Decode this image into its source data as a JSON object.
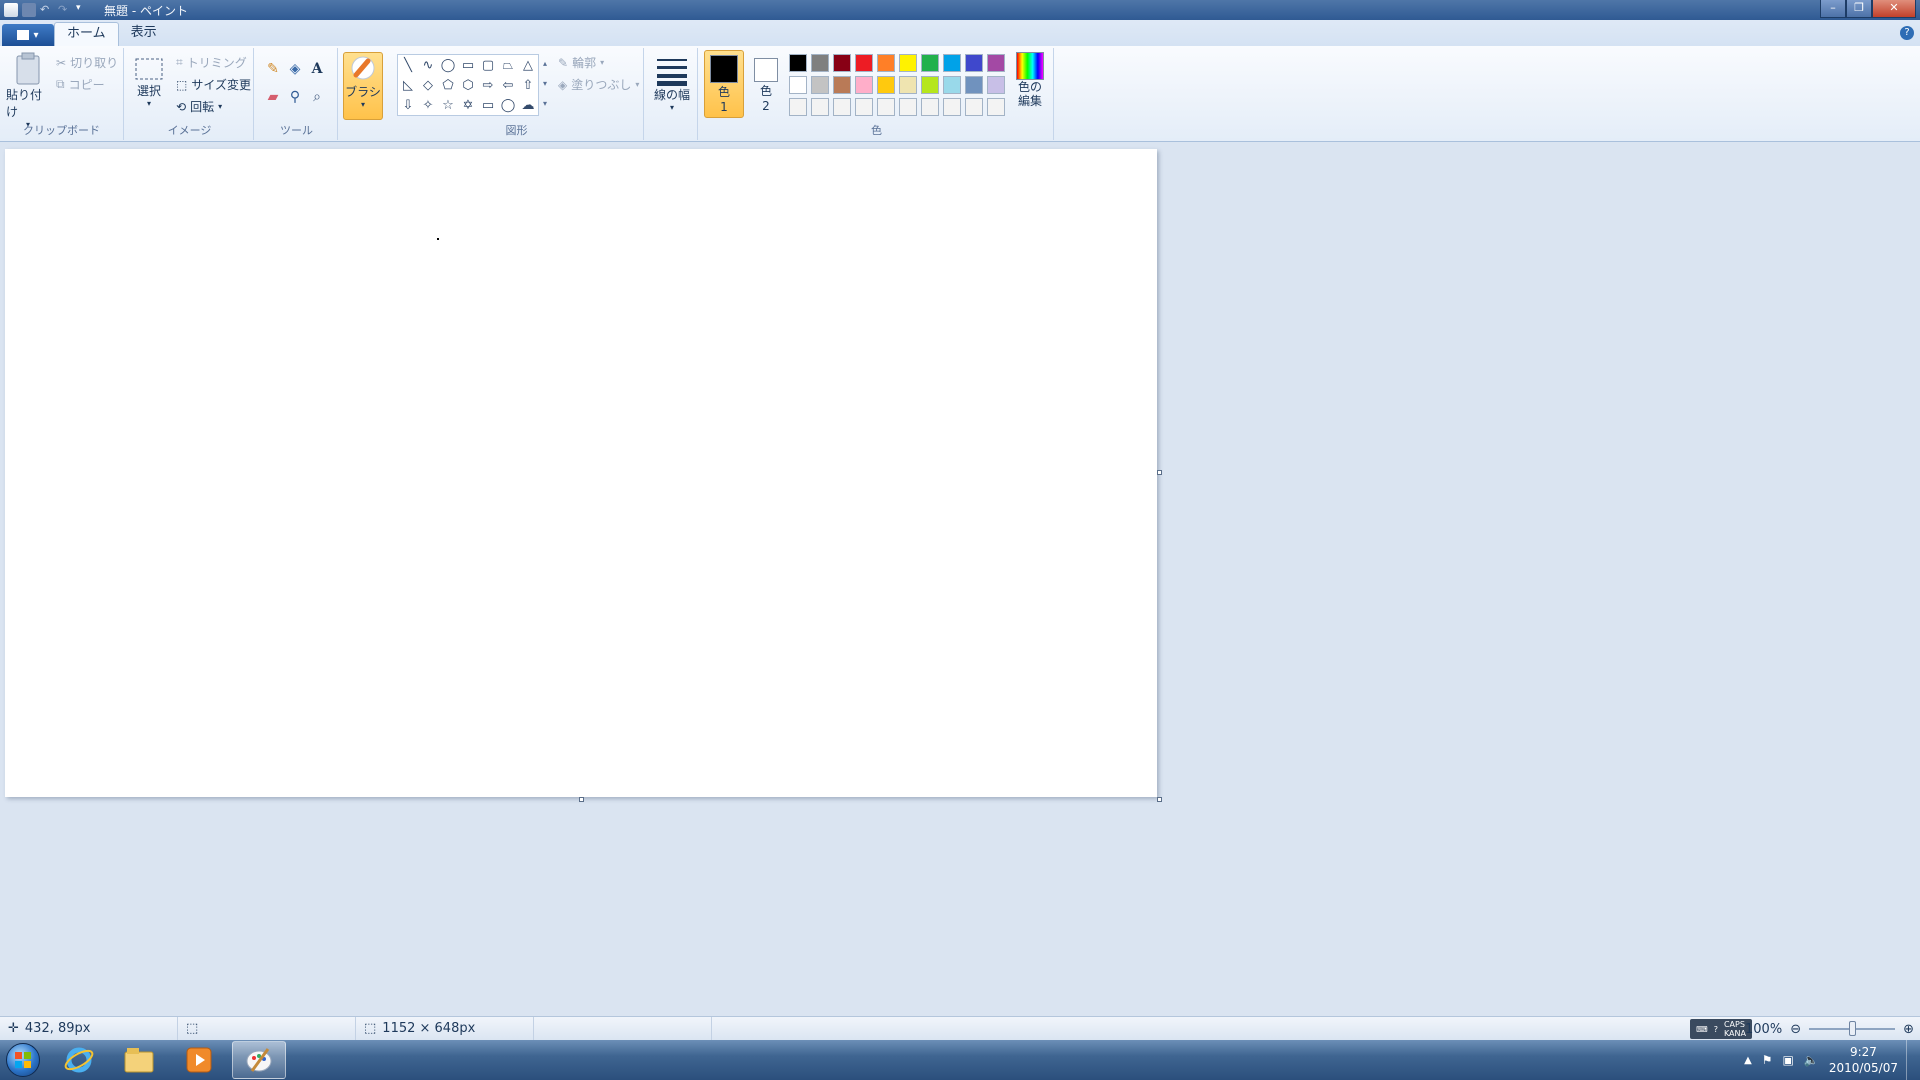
{
  "window": {
    "title": "無題 - ペイント"
  },
  "tabs": [
    {
      "label": "ホーム"
    },
    {
      "label": "表示"
    }
  ],
  "clipboard": {
    "paste": "貼り付け",
    "cut": "切り取り",
    "copy": "コピー",
    "group": "クリップボード"
  },
  "image": {
    "select": "選択",
    "crop": "トリミング",
    "resize": "サイズ変更",
    "rotate": "回転",
    "group": "イメージ"
  },
  "tools": {
    "group": "ツール"
  },
  "brushes": {
    "label": "ブラシ"
  },
  "shapes": {
    "outline": "輪郭",
    "fill": "塗りつぶし",
    "group": "図形"
  },
  "size": {
    "label": "線の幅"
  },
  "colors": {
    "color1": "色",
    "color1_num": "1",
    "color2": "色",
    "color2_num": "2",
    "edit_line1": "色の",
    "edit_line2": "編集",
    "group": "色",
    "color1_value": "#000000",
    "color2_value": "#ffffff",
    "palette": [
      "#000000",
      "#7f7f7f",
      "#880015",
      "#ed1c24",
      "#ff7f27",
      "#fff200",
      "#22b14c",
      "#00a2e8",
      "#3f48cc",
      "#a349a4",
      "#ffffff",
      "#c3c3c3",
      "#b97a57",
      "#ffaec9",
      "#ffc90e",
      "#efe4b0",
      "#b5e61d",
      "#99d9ea",
      "#7092be",
      "#c8bfe7",
      "#f3f3f3",
      "#f3f3f3",
      "#f3f3f3",
      "#f3f3f3",
      "#f3f3f3",
      "#f3f3f3",
      "#f3f3f3",
      "#f3f3f3",
      "#f3f3f3",
      "#f3f3f3"
    ]
  },
  "status": {
    "cursor": "432, 89px",
    "selection": "",
    "canvas_size": "1152 × 648px",
    "zoom": "100%"
  },
  "taskbar": {
    "time": "9:27",
    "date": "2010/05/07",
    "ime_caps": "CAPS",
    "ime_kana": "KANA"
  }
}
